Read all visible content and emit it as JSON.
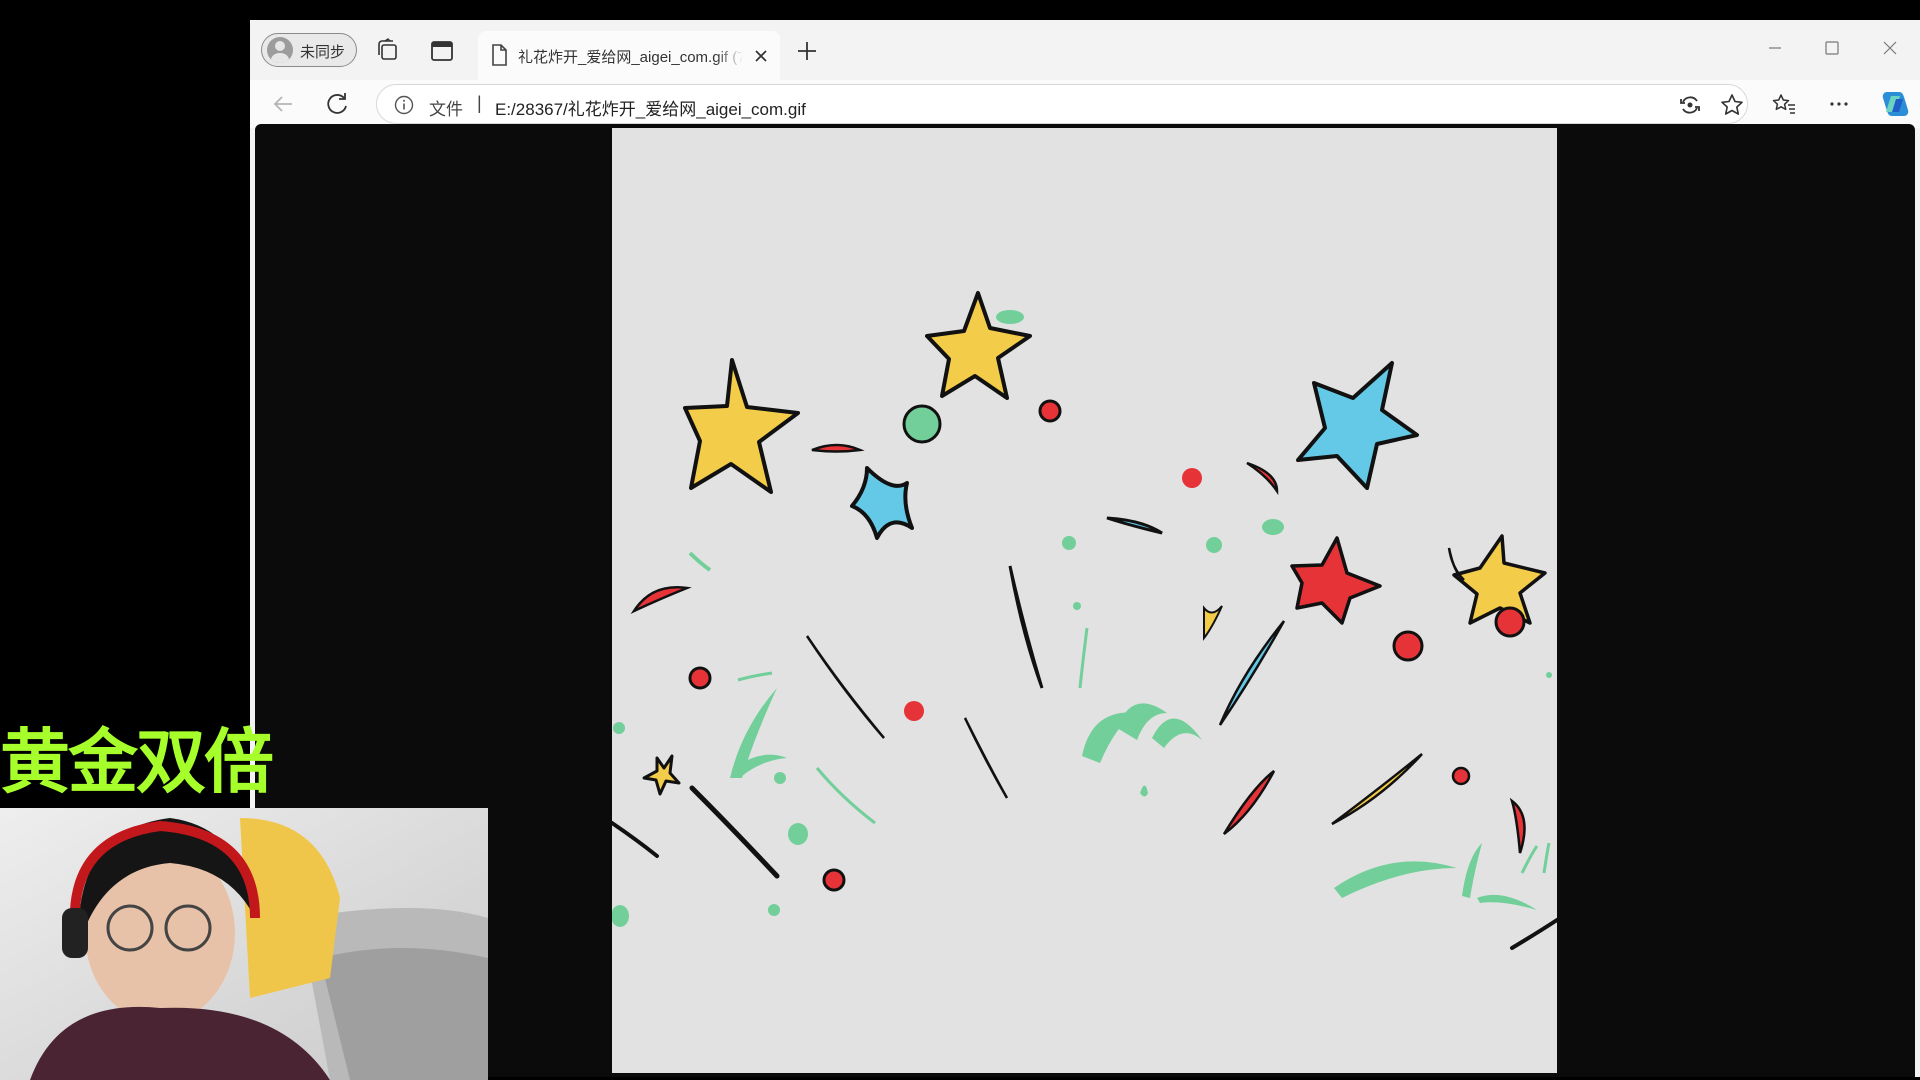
{
  "browser": {
    "profile_label": "未同步",
    "tab_title": "礼花炸开_爱给网_aigei_com.gif (7",
    "address": {
      "scheme_label": "文件",
      "separator": "|",
      "url": "E:/28367/礼花炸开_爱给网_aigei_com.gif"
    },
    "icons": [
      "profile-avatar-icon",
      "workspaces-icon",
      "vertical-tabs-icon",
      "file-icon",
      "close-icon",
      "new-tab-icon",
      "minimize-icon",
      "maximize-icon",
      "window-close-icon",
      "back-icon",
      "refresh-icon",
      "info-icon",
      "read-aloud-icon",
      "favorite-star-icon",
      "favorites-icon",
      "more-icon",
      "copilot-icon"
    ]
  },
  "gif": {
    "palette": {
      "background": "#e2e2e2",
      "yellow": "#f3cc4a",
      "blue": "#63c9e6",
      "red": "#e53338",
      "green": "#72cf9a",
      "outline": "#111111"
    }
  },
  "overlay": {
    "text": "黄金双倍",
    "text_color": "#a6ff2a"
  }
}
